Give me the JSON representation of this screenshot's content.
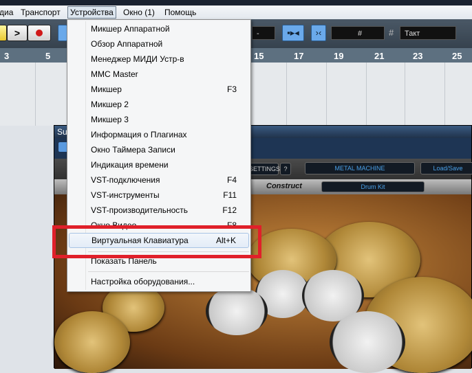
{
  "menubar": {
    "items": [
      "диа",
      "Транспорт",
      "Устройства",
      "Окно (1)",
      "Помощь"
    ]
  },
  "toolbar": {
    "play": ">",
    "snap_value": "-",
    "grid_icon": "#",
    "quantize": "Такт"
  },
  "ruler": {
    "marks": [
      "3",
      "5",
      "15",
      "17",
      "19",
      "21",
      "23",
      "25"
    ]
  },
  "plugin": {
    "title": "Sup",
    "settings": "SETTINGS",
    "help": "?",
    "preset": "METAL MACHINE",
    "load_save": "Load/Save",
    "construct_label": "Construct",
    "kit": "Drum Kit"
  },
  "menu": {
    "items": [
      {
        "label": "Микшер Аппаратной",
        "shortcut": ""
      },
      {
        "label": "Обзор Аппаратной",
        "shortcut": ""
      },
      {
        "label": "Менеджер МИДИ Устр-в",
        "shortcut": ""
      },
      {
        "label": "MMC Master",
        "shortcut": ""
      },
      {
        "label": "Микшер",
        "shortcut": "F3"
      },
      {
        "label": "Микшер 2",
        "shortcut": ""
      },
      {
        "label": "Микшер 3",
        "shortcut": ""
      },
      {
        "label": "Информация о Плагинах",
        "shortcut": ""
      },
      {
        "label": "Окно Таймера Записи",
        "shortcut": ""
      },
      {
        "label": "Индикация времени",
        "shortcut": ""
      },
      {
        "label": "VST-подключения",
        "shortcut": "F4"
      },
      {
        "label": "VST-инструменты",
        "shortcut": "F11"
      },
      {
        "label": "VST-производительность",
        "shortcut": "F12"
      },
      {
        "label": "Окно Видео",
        "shortcut": "F8"
      },
      {
        "label": "Виртуальная Клавиатура",
        "shortcut": "Alt+K"
      },
      {
        "label": "Показать Панель",
        "shortcut": ""
      },
      {
        "label": "Настройка оборудования...",
        "shortcut": ""
      }
    ]
  },
  "colors": {
    "highlight_box": "#e0202a",
    "toolbar_blue": "#6aa9ea"
  }
}
